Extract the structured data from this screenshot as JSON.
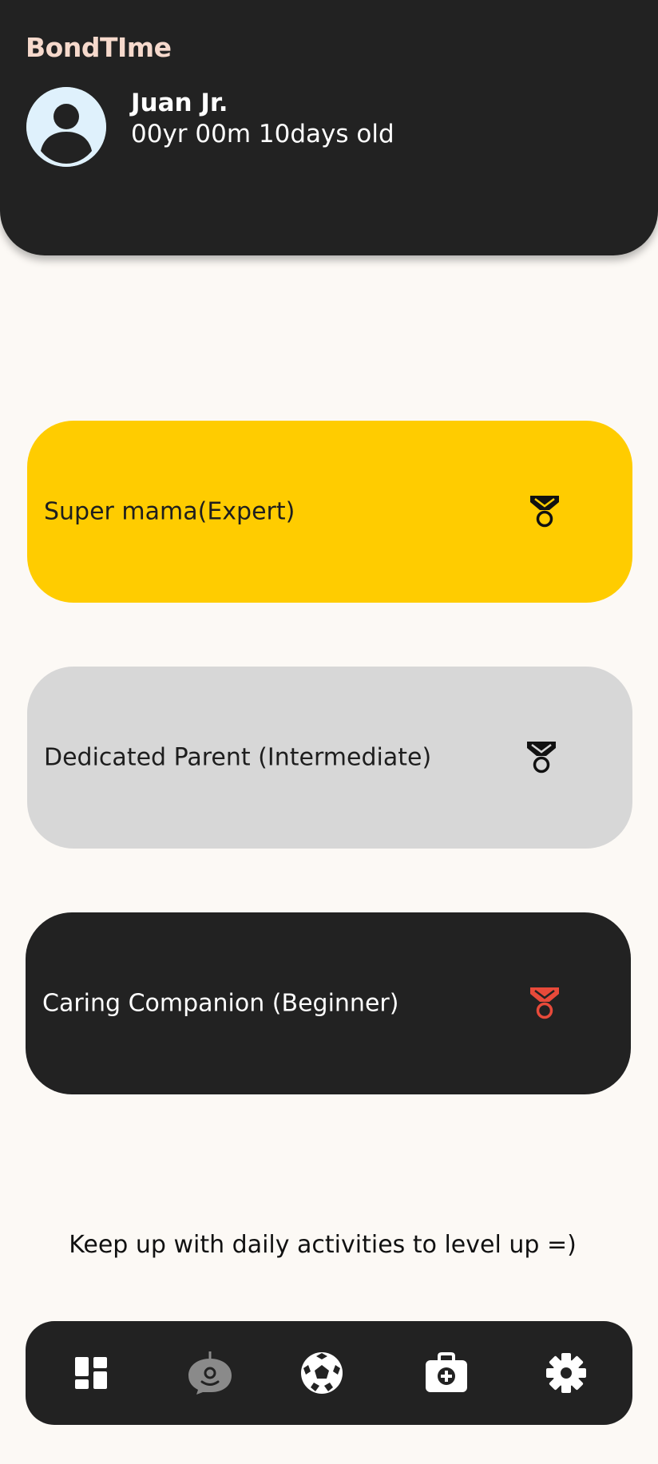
{
  "header": {
    "app_title": "BondTIme",
    "child_name": "Juan Jr.",
    "child_age": "00yr 00m 10days old",
    "avatar_icon": "person-icon"
  },
  "levels": [
    {
      "label": "Super mama(Expert)",
      "icon": "medal-icon",
      "background": "#ffcc00",
      "icon_color": "#111111"
    },
    {
      "label": "Dedicated Parent (Intermediate)",
      "icon": "medal-icon",
      "background": "#d7d7d7",
      "icon_color": "#111111"
    },
    {
      "label": "Caring Companion (Beginner)",
      "icon": "medal-icon",
      "background": "#222222",
      "icon_color": "#e84a3a"
    }
  ],
  "tip": "Keep up with daily activities to level up =)",
  "bottom_nav": {
    "items": [
      {
        "name": "dashboard",
        "icon": "dashboard-icon",
        "active": false
      },
      {
        "name": "assistant",
        "icon": "chat-bot-icon",
        "active": true
      },
      {
        "name": "activities",
        "icon": "soccer-ball-icon",
        "active": false
      },
      {
        "name": "health",
        "icon": "first-aid-kit-icon",
        "active": false
      },
      {
        "name": "settings",
        "icon": "gear-icon",
        "active": false
      }
    ]
  },
  "colors": {
    "header_bg": "#222222",
    "title_color": "#f6d9cc",
    "page_bg": "#fcf9f5",
    "expert": "#ffcc00",
    "intermediate": "#d7d7d7",
    "beginner": "#222222",
    "beginner_medal": "#e84a3a"
  }
}
